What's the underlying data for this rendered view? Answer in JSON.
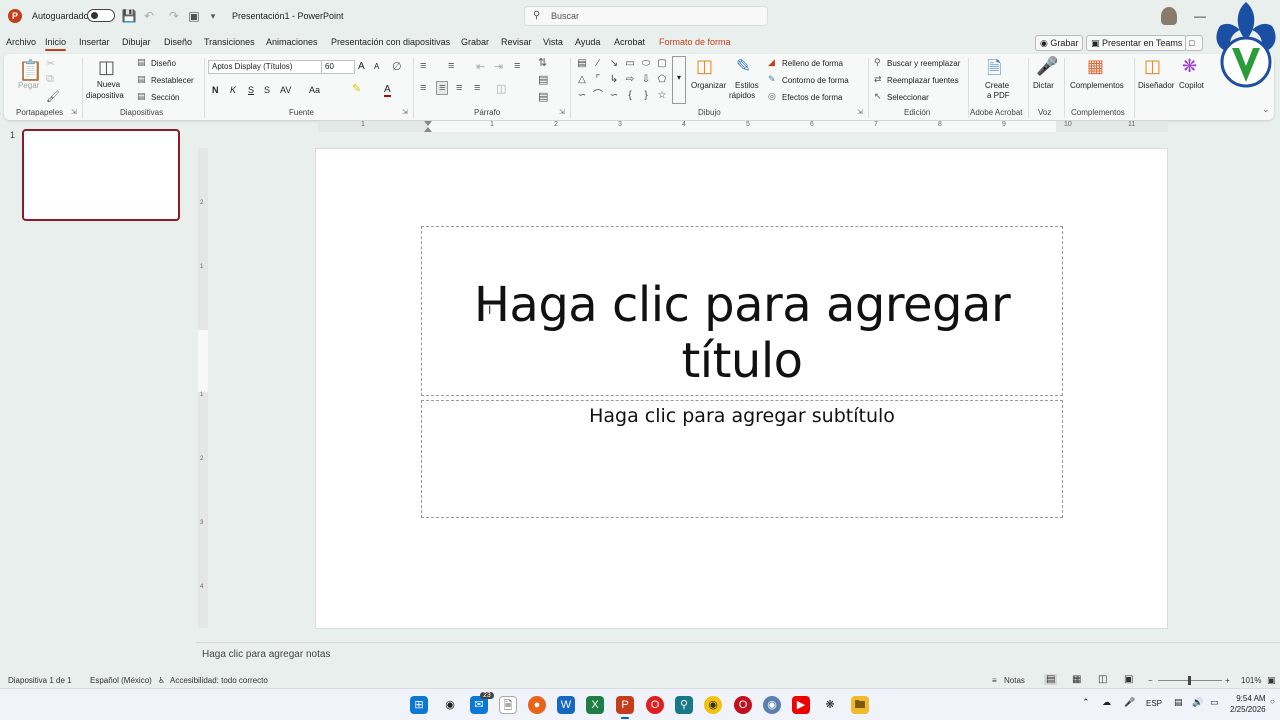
{
  "titlebar": {
    "autosave_label": "Autoguardado",
    "doc_title": "Presentación1 - PowerPoint",
    "search_placeholder": "Buscar"
  },
  "tabs": [
    {
      "label": "Archivo"
    },
    {
      "label": "Inicio"
    },
    {
      "label": "Insertar"
    },
    {
      "label": "Dibujar"
    },
    {
      "label": "Diseño"
    },
    {
      "label": "Transiciones"
    },
    {
      "label": "Animaciones"
    },
    {
      "label": "Presentación con diapositivas"
    },
    {
      "label": "Grabar"
    },
    {
      "label": "Revisar"
    },
    {
      "label": "Vista"
    },
    {
      "label": "Ayuda"
    },
    {
      "label": "Acrobat"
    },
    {
      "label": "Formato de forma"
    }
  ],
  "tab_actions": {
    "record": "Grabar",
    "present_teams": "Presentar en Teams"
  },
  "ribbon": {
    "clipboard": {
      "paste": "Pegar",
      "group": "Portapapeles"
    },
    "slides": {
      "new_slide_1": "Nueva",
      "new_slide_2": "diapositiva",
      "layout": "Diseño",
      "reset": "Restablecer",
      "section": "Sección",
      "group": "Diapositivas"
    },
    "font": {
      "font_name": "Aptos Display (Títulos)",
      "font_size": "60",
      "bold": "N",
      "italic": "K",
      "underline": "S",
      "shadow": "S",
      "spacing": "AV",
      "case": "Aa",
      "color": "A",
      "grow": "A",
      "shrink": "A",
      "group": "Fuente"
    },
    "paragraph": {
      "group": "Párrafo"
    },
    "drawing": {
      "arrange": "Organizar",
      "quick_styles_1": "Estilos",
      "quick_styles_2": "rápidos",
      "fill": "Relleno de forma",
      "outline": "Contorno de forma",
      "effects": "Efectos de forma",
      "group": "Dibujo"
    },
    "editing": {
      "find": "Buscar y reemplazar",
      "replace_fonts": "Reemplazar fuentes",
      "select": "Seleccionar",
      "group": "Edición"
    },
    "acrobat": {
      "create_1": "Create",
      "create_2": "a PDF",
      "group": "Adobe Acrobat"
    },
    "voice": {
      "dictate": "Dictar",
      "group": "Voz"
    },
    "addins": {
      "addins": "Complementos",
      "group": "Complementos"
    },
    "designer": "Diseñador",
    "copilot": "Copilot"
  },
  "slide_panel": {
    "number": "1"
  },
  "hruler_labels": [
    "1",
    "1",
    "2",
    "3",
    "4",
    "5",
    "6",
    "7",
    "8",
    "9",
    "10",
    "11"
  ],
  "vruler_labels": [
    "2",
    "1",
    "1",
    "2",
    "3",
    "4"
  ],
  "slide": {
    "title_placeholder": "Haga clic para agregar título",
    "subtitle_placeholder": "Haga clic para agregar subtítulo"
  },
  "notes": {
    "placeholder": "Haga clic para agregar notas"
  },
  "statusbar": {
    "slide_info": "Diapositiva 1 de 1",
    "language": "Español (México)",
    "accessibility": "Accesibilidad: todo correcto",
    "notes": "Notas",
    "zoom": "101%"
  },
  "taskbar": {
    "badge": "23",
    "lang": "ESP",
    "time": "9:54 AM",
    "date": "2/25/2026"
  },
  "colors": {
    "accent": "#c43e1c",
    "slide_border": "#8c1c2c",
    "background": "#e9efec"
  }
}
